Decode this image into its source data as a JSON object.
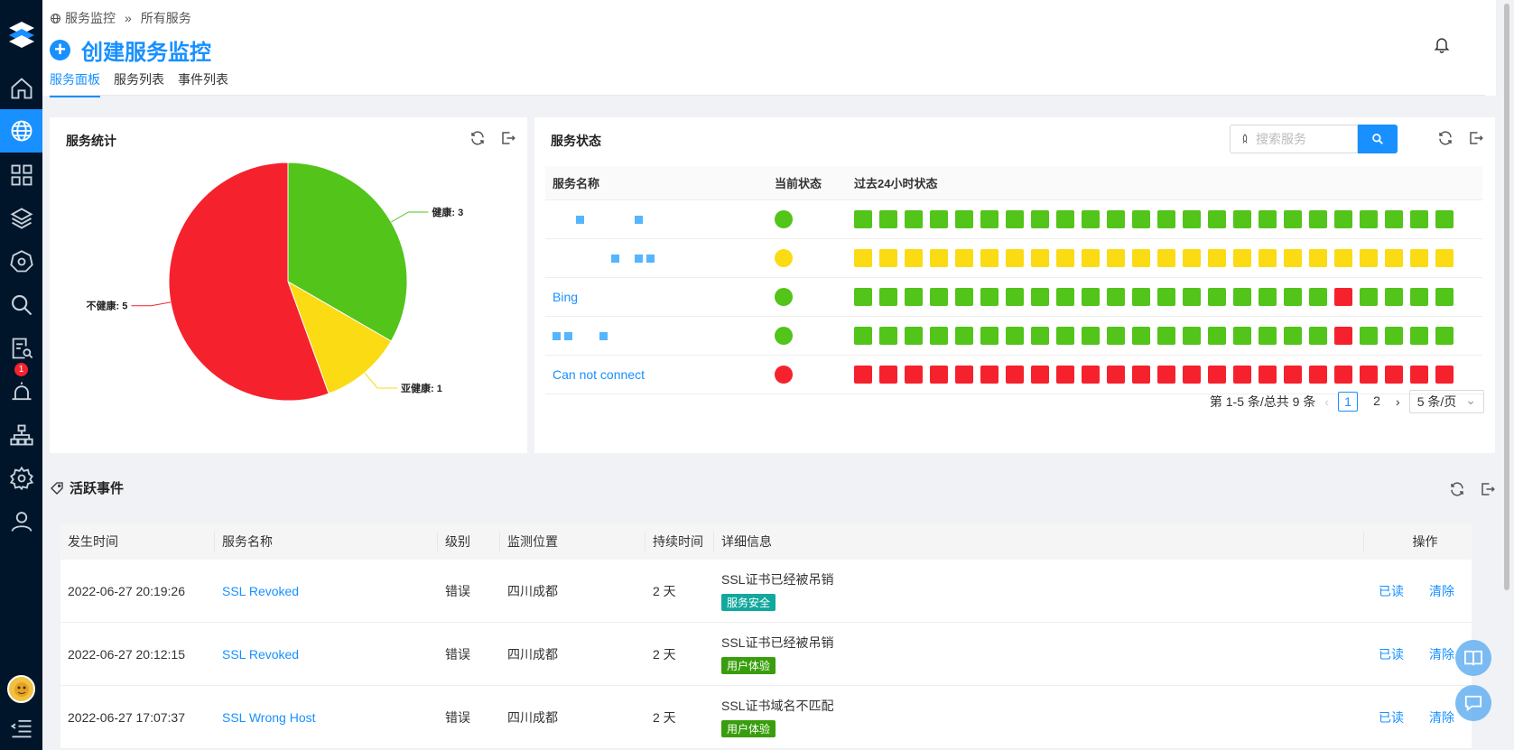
{
  "breadcrumb": {
    "root": "服务监控",
    "sep": "»",
    "current": "所有服务"
  },
  "header": {
    "title": "创建服务监控"
  },
  "tabs": [
    {
      "label": "服务面板"
    },
    {
      "label": "服务列表"
    },
    {
      "label": "事件列表"
    }
  ],
  "stats_card": {
    "title": "服务统计"
  },
  "chart_data": {
    "type": "pie",
    "slices": [
      {
        "label": "健康: 3",
        "value": 3,
        "color": "#52c41a"
      },
      {
        "label": "亚健康: 1",
        "value": 1,
        "color": "#fadb14"
      },
      {
        "label": "不健康: 5",
        "value": 5,
        "color": "#f5222d"
      }
    ]
  },
  "status_card": {
    "title": "服务状态",
    "search_placeholder": "搜索服务",
    "columns": {
      "name": "服务名称",
      "current": "当前状态",
      "history": "过去24小时状态"
    },
    "rows": [
      {
        "name": "",
        "current": "green",
        "history": "gggggggggggggggggggggggg"
      },
      {
        "name": "",
        "current": "yellow",
        "history": "yyyyyyyyyyyyyyyyyyyyyyyy"
      },
      {
        "name": "Bing",
        "current": "green",
        "history": "gggggggggggggggggggrgggg"
      },
      {
        "name": "",
        "current": "green",
        "history": "gggggggggggggggggggrgggg"
      },
      {
        "name": "Can not connect",
        "current": "red",
        "history": "rrrrrrrrrrrrrrrrrrrrrrrr"
      }
    ],
    "pager": {
      "summary": "第 1-5 条/总共 9 条",
      "page1": "1",
      "page2": "2",
      "size": "5 条/页"
    }
  },
  "events": {
    "title": "活跃事件",
    "columns": {
      "time": "发生时间",
      "name": "服务名称",
      "level": "级别",
      "location": "监测位置",
      "duration": "持续时间",
      "detail": "详细信息",
      "ops": "操作"
    },
    "rows": [
      {
        "time": "2022-06-27 20:19:26",
        "name": "SSL Revoked",
        "level": "错误",
        "location": "四川成都",
        "duration": "2 天",
        "detail": "SSL证书已经被吊销",
        "tag": "服务安全",
        "read": "已读",
        "clear": "清除"
      },
      {
        "time": "2022-06-27 20:12:15",
        "name": "SSL Revoked",
        "level": "错误",
        "location": "四川成都",
        "duration": "2 天",
        "detail": "SSL证书已经被吊销",
        "tag": "用户体验",
        "read": "已读",
        "clear": "清除"
      },
      {
        "time": "2022-06-27 17:07:37",
        "name": "SSL Wrong Host",
        "level": "错误",
        "location": "四川成都",
        "duration": "2 天",
        "detail": "SSL证书域名不匹配",
        "tag": "用户体验",
        "read": "已读",
        "clear": "清除"
      }
    ]
  },
  "sidebar": {
    "badge": "1"
  },
  "colors": {
    "green": "#52c41a",
    "yellow": "#fadb14",
    "red": "#f5222d",
    "accent": "#1890ff"
  }
}
